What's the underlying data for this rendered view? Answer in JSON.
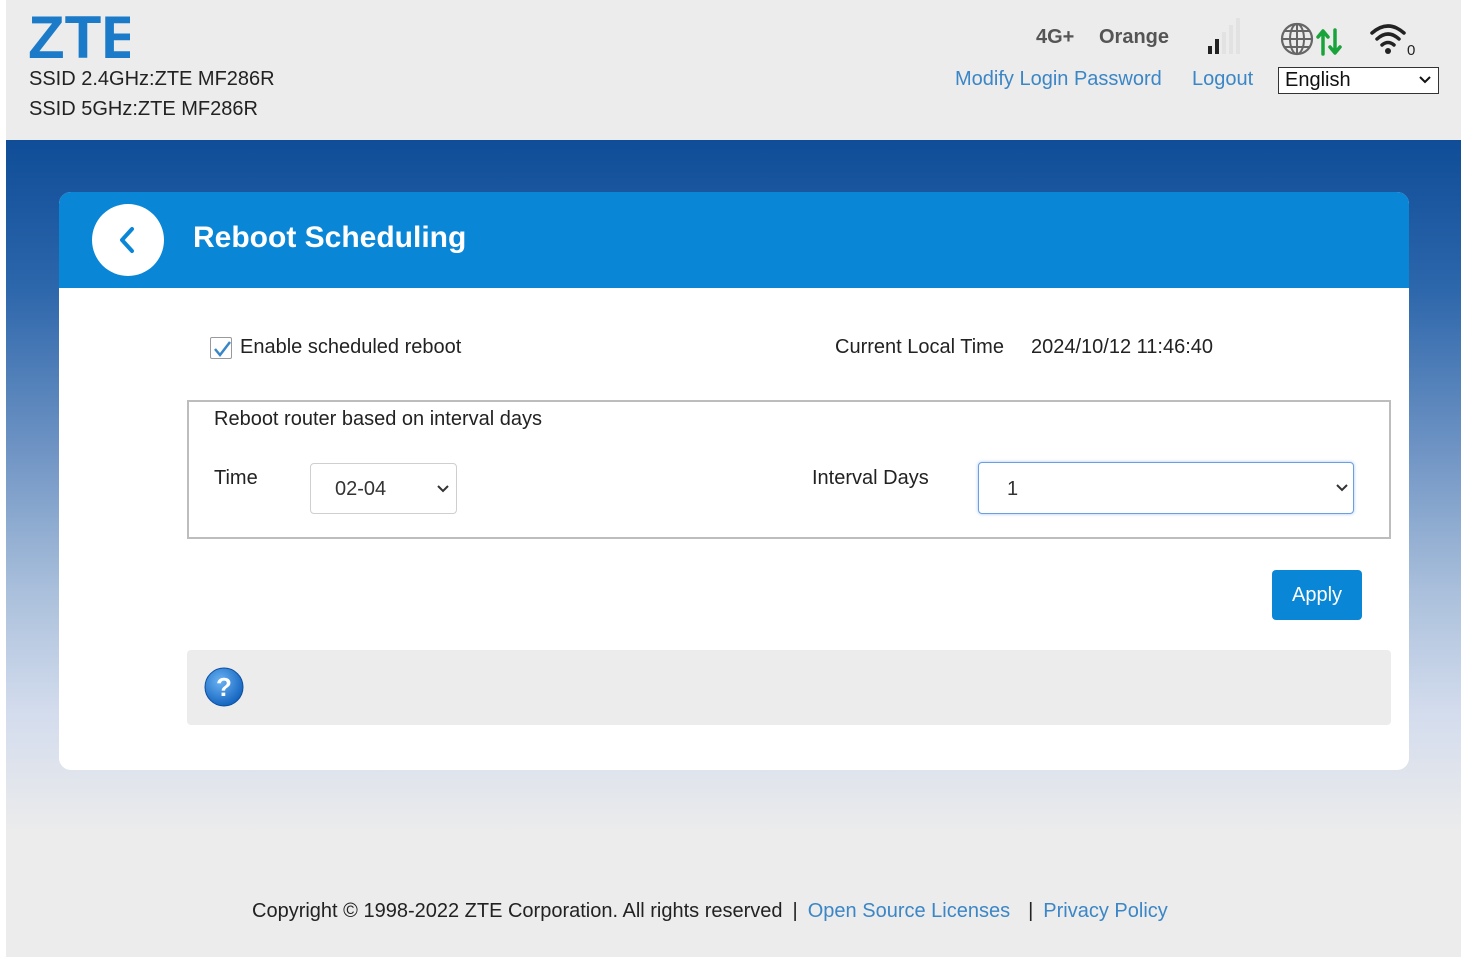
{
  "header": {
    "logo_text": "ZTE",
    "ssid_24": "SSID 2.4GHz:ZTE MF286R",
    "ssid_5": "SSID 5GHz:ZTE MF286R",
    "network_type": "4G+",
    "carrier": "Orange",
    "signal_bars_active": 2,
    "signal_bars_total": 5,
    "wifi_clients": "0",
    "modify_password_link": "Modify Login Password",
    "logout_link": "Logout",
    "language": "English"
  },
  "panel": {
    "title": "Reboot Scheduling",
    "enable_label": "Enable scheduled reboot",
    "enable_checked": true,
    "current_time_label": "Current Local Time",
    "current_time_value": "2024/10/12 11:46:40",
    "group_title": "Reboot router based on interval days",
    "time_label": "Time",
    "time_value": "02-04",
    "interval_label": "Interval Days",
    "interval_value": "1",
    "apply_label": "Apply"
  },
  "footer": {
    "copyright": "Copyright © 1998-2022 ZTE Corporation. All rights reserved",
    "separator": "|",
    "open_source_link": "Open Source Licenses",
    "privacy_link": "Privacy Policy"
  },
  "colors": {
    "brand_blue": "#0a86d6",
    "link_blue": "#3b86c6",
    "logo_blue": "#1c7bc9",
    "traffic_green": "#1aa33a"
  }
}
